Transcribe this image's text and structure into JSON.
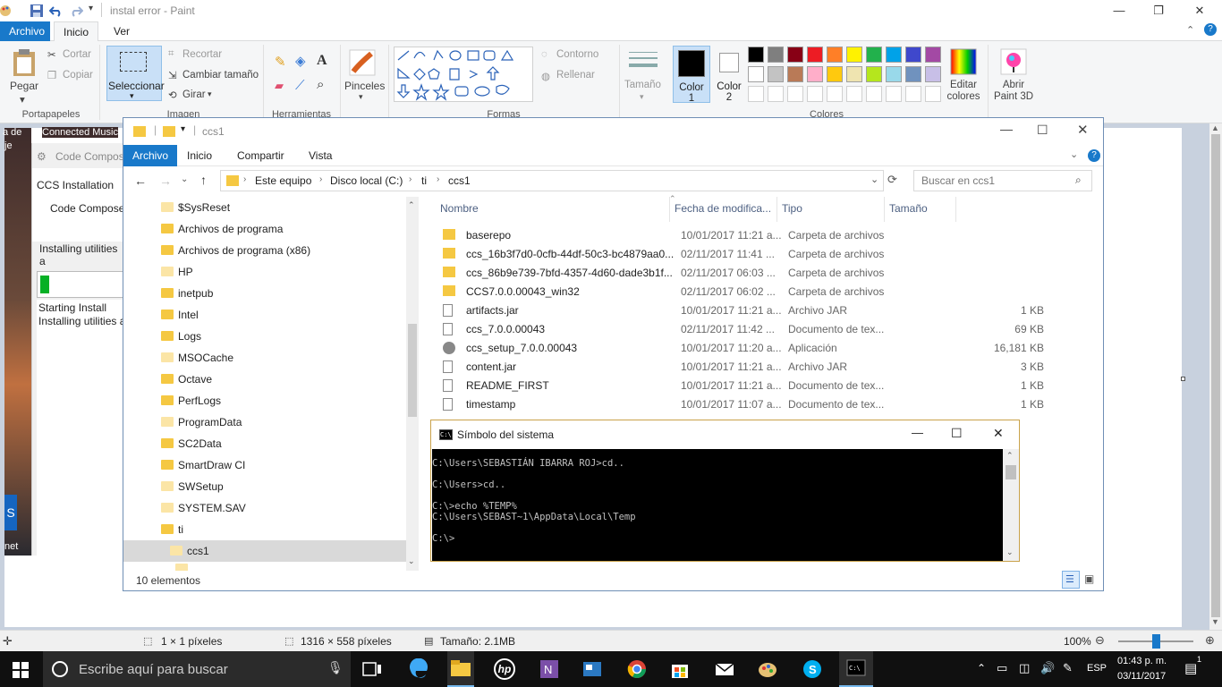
{
  "paint": {
    "title": "instal error - Paint",
    "tabs": [
      "Archivo",
      "Inicio",
      "Ver"
    ],
    "clipboard": {
      "paste": "Pegar",
      "cut": "Cortar",
      "copy": "Copiar",
      "group": "Portapapeles"
    },
    "image": {
      "select": "Seleccionar",
      "crop": "Recortar",
      "resize": "Cambiar tamaño",
      "rotate": "Girar",
      "group": "Imagen"
    },
    "tools_group": "Herramientas",
    "brushes": "Pinceles",
    "shapes": {
      "outline": "Contorno",
      "fill": "Rellenar",
      "group": "Formas"
    },
    "size": "Tamaño",
    "color1": "Color 1",
    "color2": "Color 2",
    "colors_group": "Colores",
    "edit_colors": "Editar colores",
    "open_paint3d": "Abrir Paint 3D",
    "palette_row1": [
      "#000000",
      "#7f7f7f",
      "#880015",
      "#ed1c24",
      "#ff7f27",
      "#fff200",
      "#22b14c",
      "#00a2e8",
      "#3f48cc",
      "#a349a4"
    ],
    "palette_row2": [
      "#ffffff",
      "#c3c3c3",
      "#b97a57",
      "#ffaec9",
      "#ffc90e",
      "#efe4b0",
      "#b5e61d",
      "#99d9ea",
      "#7092be",
      "#c8bfe7"
    ],
    "status": {
      "selection": "1 × 1 píxeles",
      "canvas_size": "1316 × 558 píxeles",
      "file_size": "Tamaño: 2.1MB",
      "zoom": "100%"
    }
  },
  "background": {
    "left_texts": [
      "a de",
      "je",
      "net"
    ],
    "connected": "Connected Music",
    "installer_title": "Code Compos",
    "installer_heading": "CCS Installation",
    "installer_sub": "Code Compose",
    "installer_line": "Installing utilities a",
    "log1": "Starting Install",
    "log2": "Installing utilities a"
  },
  "explorer": {
    "title": "ccs1",
    "tabs": [
      "Archivo",
      "Inicio",
      "Compartir",
      "Vista"
    ],
    "breadcrumb": [
      "Este equipo",
      "Disco local (C:)",
      "ti",
      "ccs1"
    ],
    "search_placeholder": "Buscar en ccs1",
    "tree": [
      "$SysReset",
      "Archivos de programa",
      "Archivos de programa (x86)",
      "HP",
      "inetpub",
      "Intel",
      "Logs",
      "MSOCache",
      "Octave",
      "PerfLogs",
      "ProgramData",
      "SC2Data",
      "SmartDraw CI",
      "SWSetup",
      "SYSTEM.SAV",
      "ti",
      "ccs1"
    ],
    "columns": [
      "Nombre",
      "Fecha de modifica...",
      "Tipo",
      "Tamaño"
    ],
    "files": [
      {
        "name": "baserepo",
        "date": "10/01/2017 11:21 a...",
        "type": "Carpeta de archivos",
        "size": ""
      },
      {
        "name": "ccs_16b3f7d0-0cfb-44df-50c3-bc4879aa0...",
        "date": "02/11/2017 11:41 ...",
        "type": "Carpeta de archivos",
        "size": ""
      },
      {
        "name": "ccs_86b9e739-7bfd-4357-4d60-dade3b1f...",
        "date": "02/11/2017 06:03 ...",
        "type": "Carpeta de archivos",
        "size": ""
      },
      {
        "name": "CCS7.0.0.00043_win32",
        "date": "02/11/2017 06:02 ...",
        "type": "Carpeta de archivos",
        "size": ""
      },
      {
        "name": "artifacts.jar",
        "date": "10/01/2017 11:21 a...",
        "type": "Archivo JAR",
        "size": "1 KB"
      },
      {
        "name": "ccs_7.0.0.00043",
        "date": "02/11/2017 11:42 ...",
        "type": "Documento de tex...",
        "size": "69 KB"
      },
      {
        "name": "ccs_setup_7.0.0.00043",
        "date": "10/01/2017 11:20 a...",
        "type": "Aplicación",
        "size": "16,181 KB"
      },
      {
        "name": "content.jar",
        "date": "10/01/2017 11:21 a...",
        "type": "Archivo JAR",
        "size": "3 KB"
      },
      {
        "name": "README_FIRST",
        "date": "10/01/2017 11:21 a...",
        "type": "Documento de tex...",
        "size": "1 KB"
      },
      {
        "name": "timestamp",
        "date": "10/01/2017 11:07 a...",
        "type": "Documento de tex...",
        "size": "1 KB"
      }
    ],
    "status": "10 elementos"
  },
  "cmd": {
    "title": "Símbolo del sistema",
    "lines": [
      "C:\\Users\\SEBASTIÁN IBARRA ROJ>cd..",
      "",
      "C:\\Users>cd..",
      "",
      "C:\\>echo %TEMP%",
      "C:\\Users\\SEBAST~1\\AppData\\Local\\Temp",
      "",
      "C:\\>"
    ]
  },
  "taskbar": {
    "search_placeholder": "Escribe aquí para buscar",
    "lang": "ESP",
    "time": "01:43 p. m.",
    "date": "03/11/2017",
    "notifications": "1"
  }
}
